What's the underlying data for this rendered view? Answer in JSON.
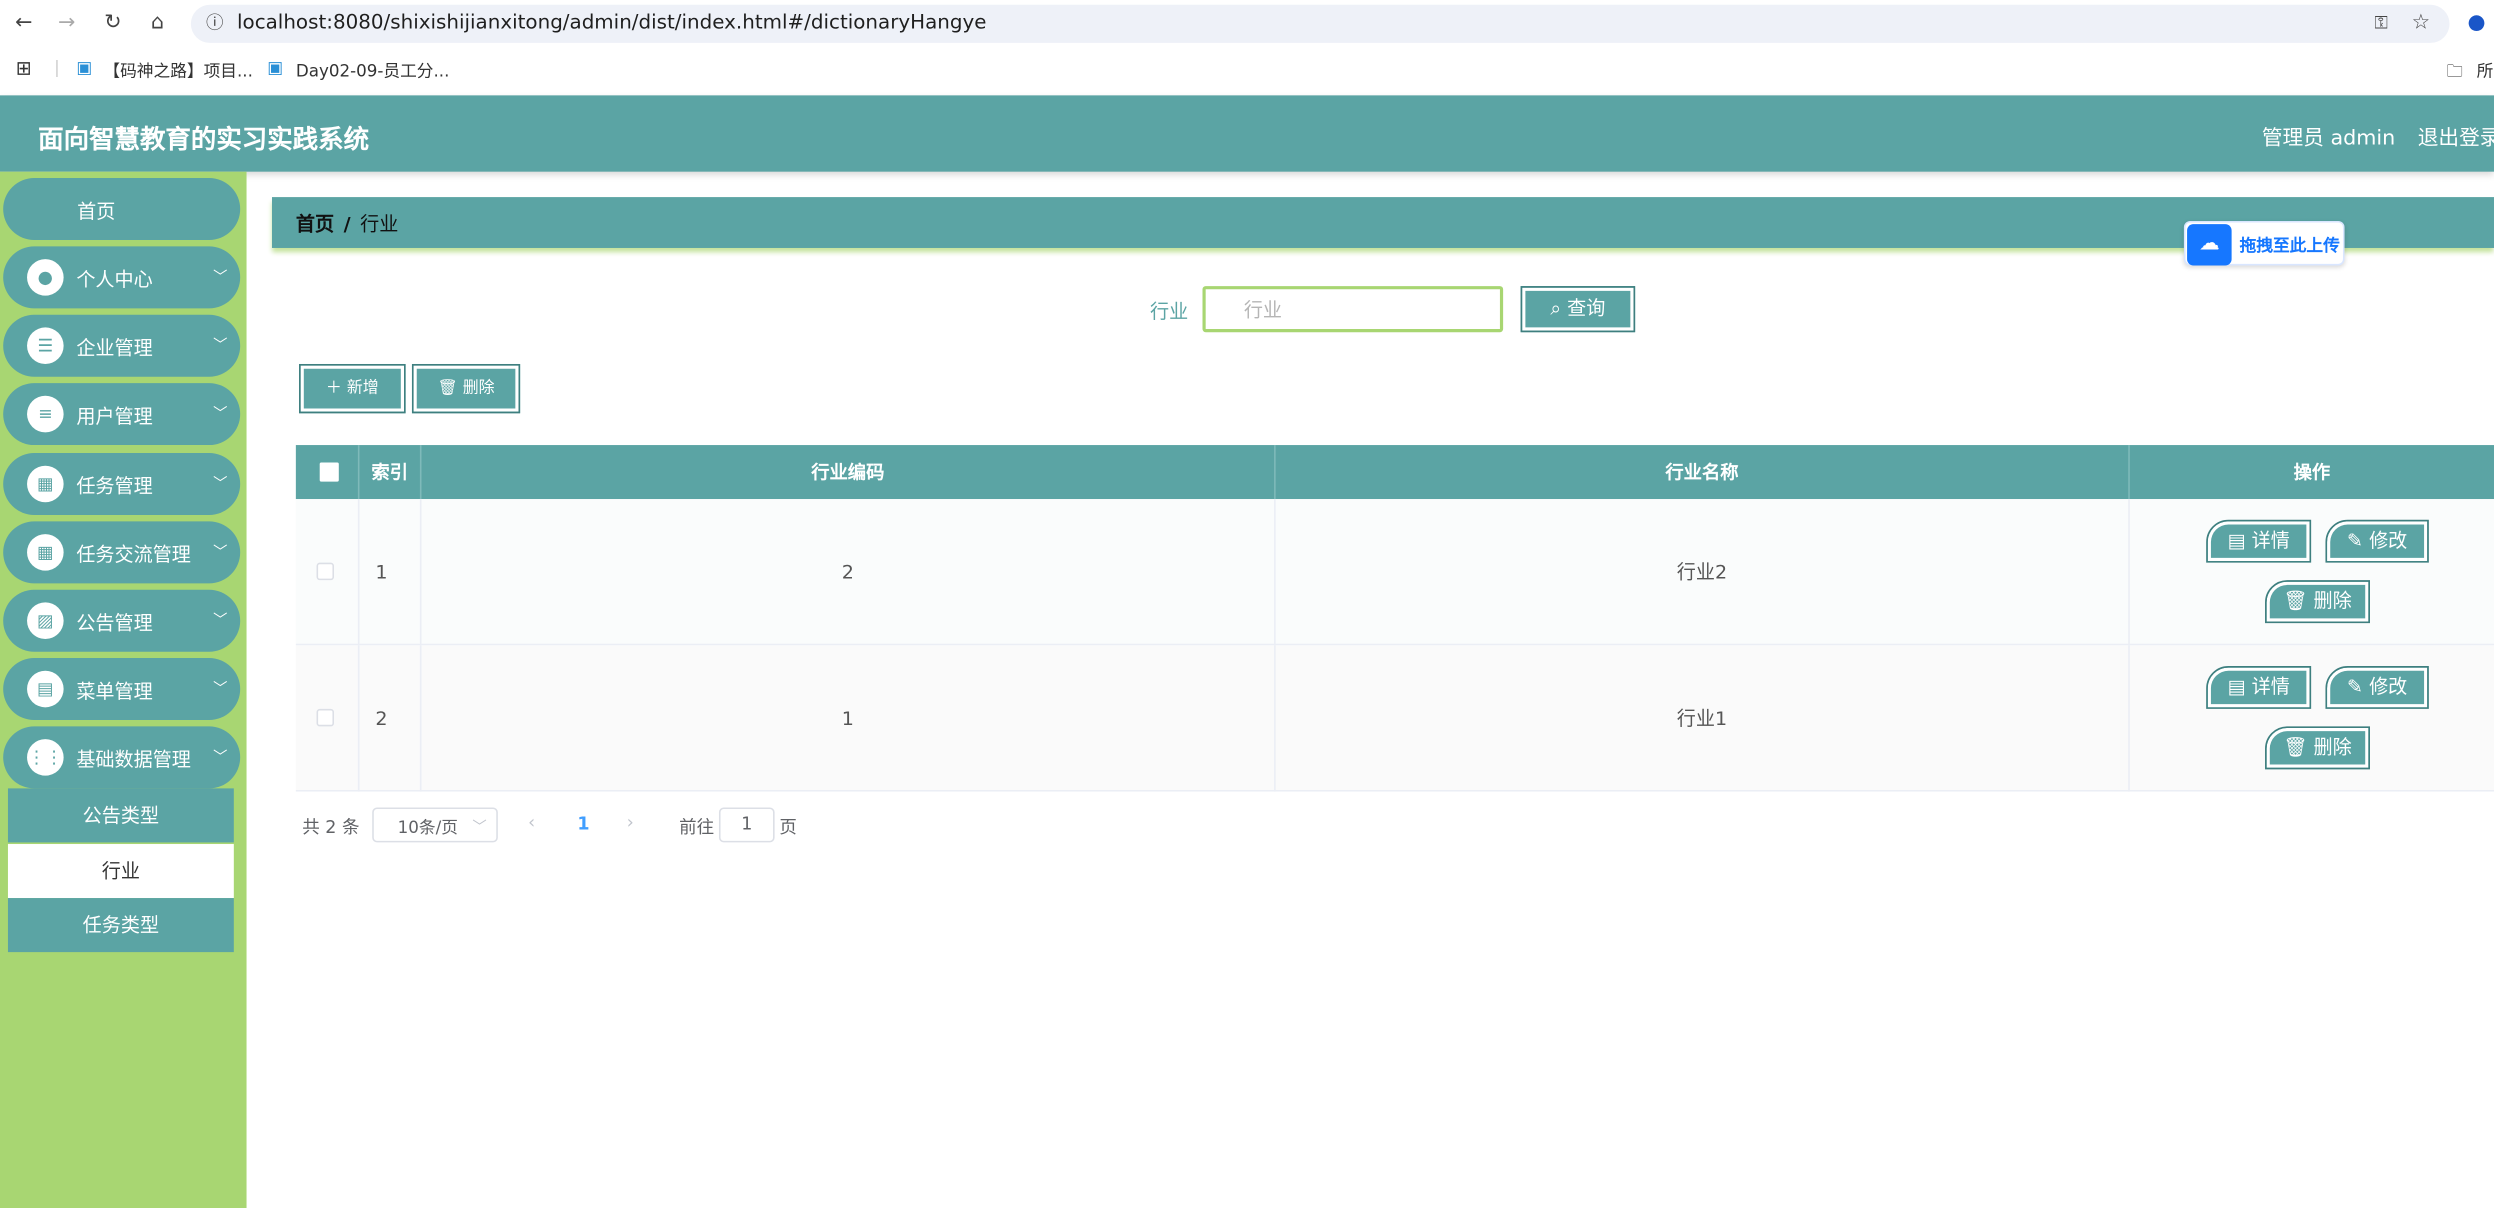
{
  "browser": {
    "url": "localhost:8080/shixishijianxitong/admin/dist/index.html#/dictionaryHangye",
    "bookmarks": [
      "【码神之路】项目...",
      "Day02-09-员工分..."
    ],
    "bookmark_folder": "所"
  },
  "header": {
    "title": "面向智慧教育的实习实践系统",
    "user": "管理员 admin",
    "logout": "退出登录"
  },
  "sidebar": {
    "home": "首页",
    "items": [
      {
        "label": "个人中心",
        "icon": "user-icon"
      },
      {
        "label": "企业管理",
        "icon": "sliders-icon"
      },
      {
        "label": "用户管理",
        "icon": "list-icon"
      },
      {
        "label": "任务管理",
        "icon": "grid-icon"
      },
      {
        "label": "任务交流管理",
        "icon": "grid-icon"
      },
      {
        "label": "公告管理",
        "icon": "chart-icon"
      },
      {
        "label": "菜单管理",
        "icon": "clipboard-icon"
      },
      {
        "label": "基础数据管理",
        "icon": "apps-icon"
      }
    ],
    "submenu": [
      "公告类型",
      "行业",
      "任务类型"
    ]
  },
  "breadcrumb": {
    "home": "首页",
    "sep": "/",
    "current": "行业"
  },
  "upload": {
    "label": "拖拽至此上传"
  },
  "search": {
    "label": "行业",
    "placeholder": "行业",
    "button": "查询"
  },
  "actions": {
    "add": "新增",
    "delete": "删除"
  },
  "table": {
    "columns": [
      "索引",
      "行业编码",
      "行业名称",
      "操作"
    ],
    "rows": [
      {
        "index": "1",
        "code": "2",
        "name": "行业2"
      },
      {
        "index": "2",
        "code": "1",
        "name": "行业1"
      }
    ],
    "row_actions": {
      "detail": "详情",
      "edit": "修改",
      "delete": "删除"
    }
  },
  "pagination": {
    "total": "共 2 条",
    "page_size": "10条/页",
    "current_page": "1",
    "goto_label": "前往",
    "goto_value": "1",
    "page_suffix": "页"
  },
  "colors": {
    "primary": "#5ba4a4",
    "sidebar_bg": "#a8d672",
    "accent_blue": "#409eff"
  }
}
